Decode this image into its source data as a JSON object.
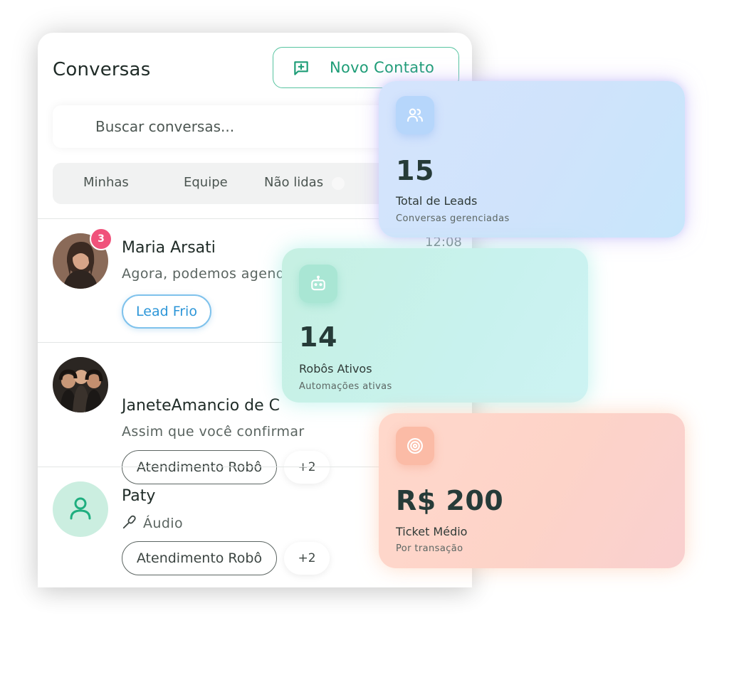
{
  "panel": {
    "title": "Conversas",
    "new_contact_label": "Novo Contato",
    "search_placeholder": "Buscar conversas...",
    "filters": [
      "Minhas",
      "Equipe",
      "Não lidas"
    ]
  },
  "conversations": [
    {
      "name": "Maria Arsati",
      "preview": "Agora, podemos agenda",
      "time": "12:08",
      "unread_count": "3",
      "tag": "Lead Frio"
    },
    {
      "name": "JaneteAmancio de C",
      "preview": "Assim que você confirmar",
      "tag": "Atendimento Robô",
      "more": "+2"
    },
    {
      "name": "Paty",
      "preview": "Áudio",
      "tag": "Atendimento Robô",
      "more": "+2"
    }
  ],
  "cards": [
    {
      "value": "15",
      "label": "Total de Leads",
      "sub": "Conversas gerenciadas",
      "icon": "users-icon",
      "color": "#cfe3fb"
    },
    {
      "value": "14",
      "label": "Robôs Ativos",
      "sub": "Automações ativas",
      "icon": "robot-icon",
      "color": "#c6f0e2"
    },
    {
      "value": "R$ 200",
      "label": "Ticket Médio",
      "sub": "Por transação",
      "icon": "target-icon",
      "color": "#fdd3c8"
    }
  ],
  "colors": {
    "accent": "#1e9d77",
    "badge": "#f0527b",
    "tag_blue": "#2d96d8"
  }
}
